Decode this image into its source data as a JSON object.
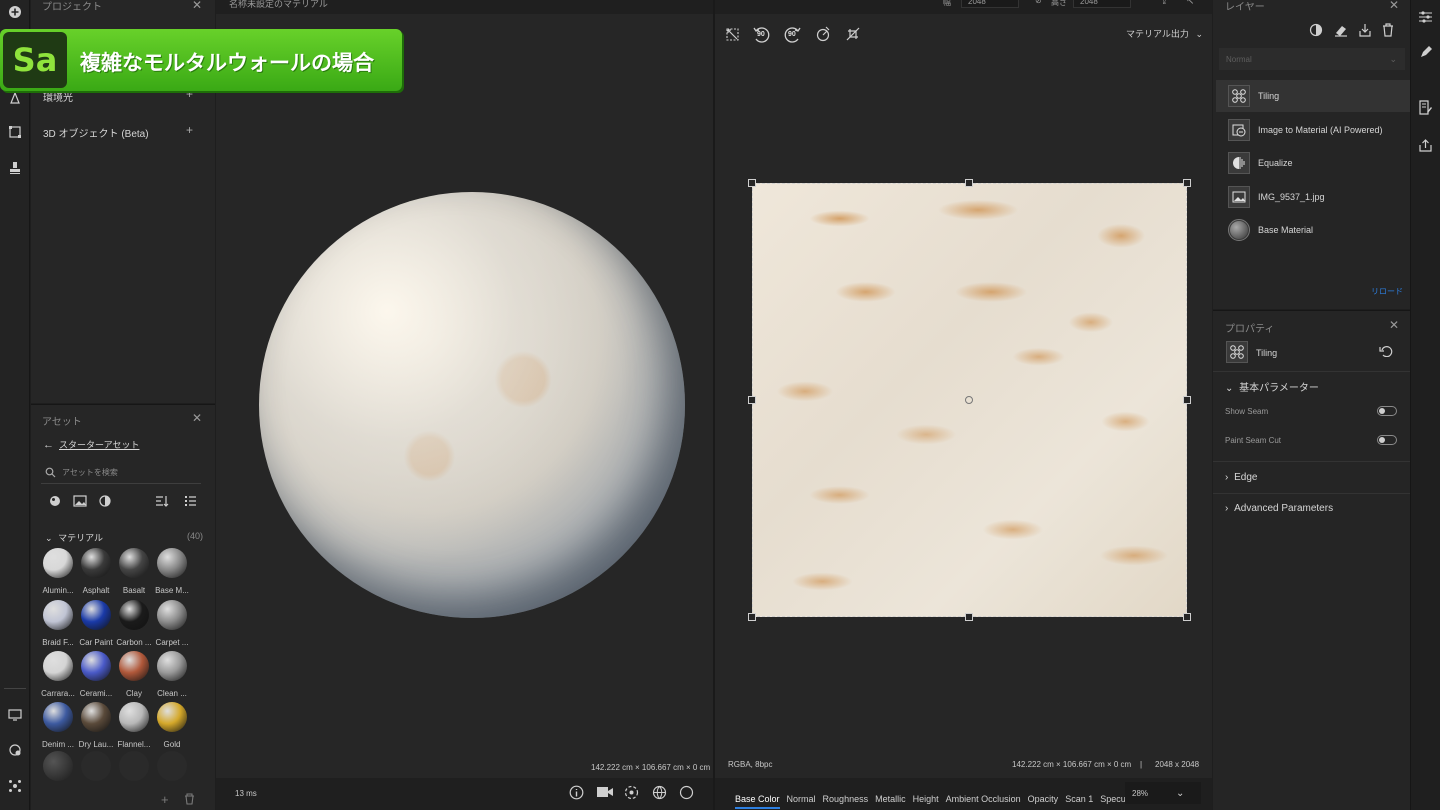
{
  "banner": {
    "logo": "Sa",
    "title": "複雑なモルタルウォールの場合"
  },
  "left_panel": {
    "title": "プロジェクト",
    "rows": [
      {
        "label": "環境光"
      },
      {
        "label": "3D オブジェクト (Beta)"
      }
    ]
  },
  "viewport3d": {
    "title": "名称未設定のマテリアル",
    "dimensions": "142.222 cm × 106.667 cm × 0 cm",
    "render_time": "13 ms"
  },
  "viewport2d": {
    "output_label": "マテリアル出力",
    "format": "RGBA, 8bpc",
    "dimensions": "142.222 cm × 106.667 cm × 0 cm",
    "resolution": "2048 x 2048",
    "zoom": "28%",
    "channels": [
      "Base Color",
      "Normal",
      "Roughness",
      "Metallic",
      "Height",
      "Ambient Occlusion",
      "Opacity",
      "Scan 1",
      "Specular"
    ],
    "active_channel": "Base Color",
    "rot_left": "90",
    "rot_right": "90"
  },
  "topbar": {
    "width_label": "幅",
    "width_value": "2048",
    "height_label": "高さ",
    "height_value": "2048"
  },
  "assets": {
    "title": "アセット",
    "back_label": "スターターアセット",
    "search_placeholder": "アセットを検索",
    "section_label": "マテリアル",
    "section_count": "(40)",
    "items": [
      {
        "label": "Alumin...",
        "color": "#d8d8d8"
      },
      {
        "label": "Asphalt",
        "color": "#3a3a3a"
      },
      {
        "label": "Basalt",
        "color": "#454545"
      },
      {
        "label": "Base M...",
        "color": "#8a8a8a"
      },
      {
        "label": "Braid F...",
        "color": "#c0c4d4"
      },
      {
        "label": "Car Paint",
        "color": "#1a3aa8"
      },
      {
        "label": "Carbon ...",
        "color": "#1b1b1b"
      },
      {
        "label": "Carpet ...",
        "color": "#8d8d8d"
      },
      {
        "label": "Carrara...",
        "color": "#d4d4d4"
      },
      {
        "label": "Cerami...",
        "color": "#4a5ac8"
      },
      {
        "label": "Clay",
        "color": "#b0583a"
      },
      {
        "label": "Clean ...",
        "color": "#9a9a9a"
      },
      {
        "label": "Denim ...",
        "color": "#3d5aa0"
      },
      {
        "label": "Dry Lau...",
        "color": "#5a4a3a"
      },
      {
        "label": "Flannel...",
        "color": "#b8b8b8"
      },
      {
        "label": "Gold",
        "color": "#d4a82a"
      }
    ]
  },
  "layers": {
    "title": "レイヤー",
    "blend_mode": "Normal",
    "items": [
      {
        "name": "Tiling",
        "icon": "tiling-icon"
      },
      {
        "name": "Image to Material (AI Powered)",
        "icon": "image-to-material-icon"
      },
      {
        "name": "Equalize",
        "icon": "equalize-icon"
      },
      {
        "name": "IMG_9537_1.jpg",
        "icon": "image-icon"
      },
      {
        "name": "Base Material",
        "icon": "sphere-icon"
      }
    ],
    "reload_label": "リロード"
  },
  "properties": {
    "title": "プロパティ",
    "layer_name": "Tiling",
    "section_basic": "基本パラメーター",
    "show_seam": "Show Seam",
    "paint_seam_cut": "Paint Seam Cut",
    "section_edge": "Edge",
    "section_advanced": "Advanced Parameters"
  },
  "colors": {
    "accent": "#2d7fe0",
    "banner_green": "#4fbf1e"
  }
}
